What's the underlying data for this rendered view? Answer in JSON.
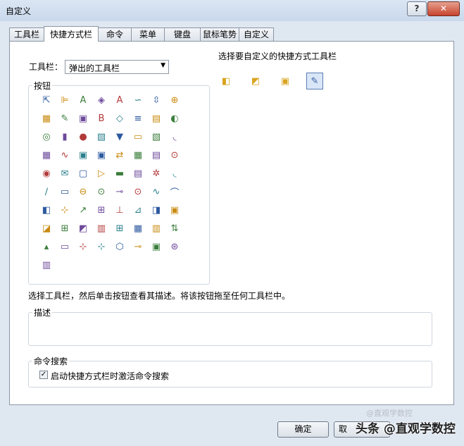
{
  "window": {
    "title": "自定义",
    "help_glyph": "?",
    "close_glyph": "✕"
  },
  "tabs": [
    "工具栏",
    "快捷方式栏",
    "命令",
    "菜单",
    "键盘",
    "鼠标笔势",
    "自定义"
  ],
  "active_tab": "快捷方式栏",
  "toolbar_field": {
    "label": "工具栏：",
    "value": "弹出的工具栏"
  },
  "select_shortcut_label": "选择要自定义的快捷方式工具栏",
  "shortcut_toolbars": [
    {
      "name": "part-toolbar-icon",
      "glyph": "◧",
      "color": "#d9a420"
    },
    {
      "name": "assembly-toolbar-icon",
      "glyph": "◩",
      "color": "#d9a420"
    },
    {
      "name": "drawing-toolbar-icon",
      "glyph": "▣",
      "color": "#d9a420"
    },
    {
      "name": "sketch-toolbar-icon",
      "glyph": "✎",
      "color": "#3a5f9e"
    }
  ],
  "buttons_group_label": "按钮",
  "button_icons": [
    [
      "⇱",
      "⊫",
      "A",
      "◈",
      "A",
      "∽",
      "⇳",
      "⊕"
    ],
    [
      "▦",
      "✎",
      "▣",
      "B",
      "◇",
      "≡",
      "▤",
      "◐"
    ],
    [
      "◎",
      "▮",
      "●",
      "▧",
      "▼",
      "▭",
      "▧",
      "◟"
    ],
    [
      "▦",
      "∿",
      "▣",
      "▣",
      "⇄",
      "▦",
      "▤",
      "⊙"
    ],
    [
      "◉",
      "✉",
      "▢",
      "▷",
      "▬",
      "▤",
      "✲",
      "◟"
    ],
    [
      "∕",
      "▭",
      "⊖",
      "⊙",
      "⊸",
      "⊙",
      "∿",
      "⌒"
    ],
    [
      "◧",
      "⊹",
      "↗",
      "⊞",
      "⊥",
      "⊿",
      "◨",
      "▣"
    ],
    [
      "◪",
      "⊞",
      "◩",
      "▥",
      "⊞",
      "▦",
      "▥",
      "⇅"
    ],
    [
      "▴",
      "▭",
      "⊹",
      "⊹",
      "⬡",
      "⊸",
      "▣",
      "⊛"
    ],
    [
      "▥"
    ]
  ],
  "hint_text": "选择工具栏，然后单击按钮查看其描述。将该按钮拖至任何工具栏中。",
  "description_group_label": "描述",
  "command_search_group_label": "命令搜索",
  "command_search_checkbox": {
    "label": "启动快捷方式栏时激活命令搜索",
    "checked": true,
    "mark": "✓"
  },
  "ok_label": "确定",
  "cancel_label_partial": "取",
  "watermark": "头条 @直观学数控",
  "watermark_faint": "@直观学数控"
}
